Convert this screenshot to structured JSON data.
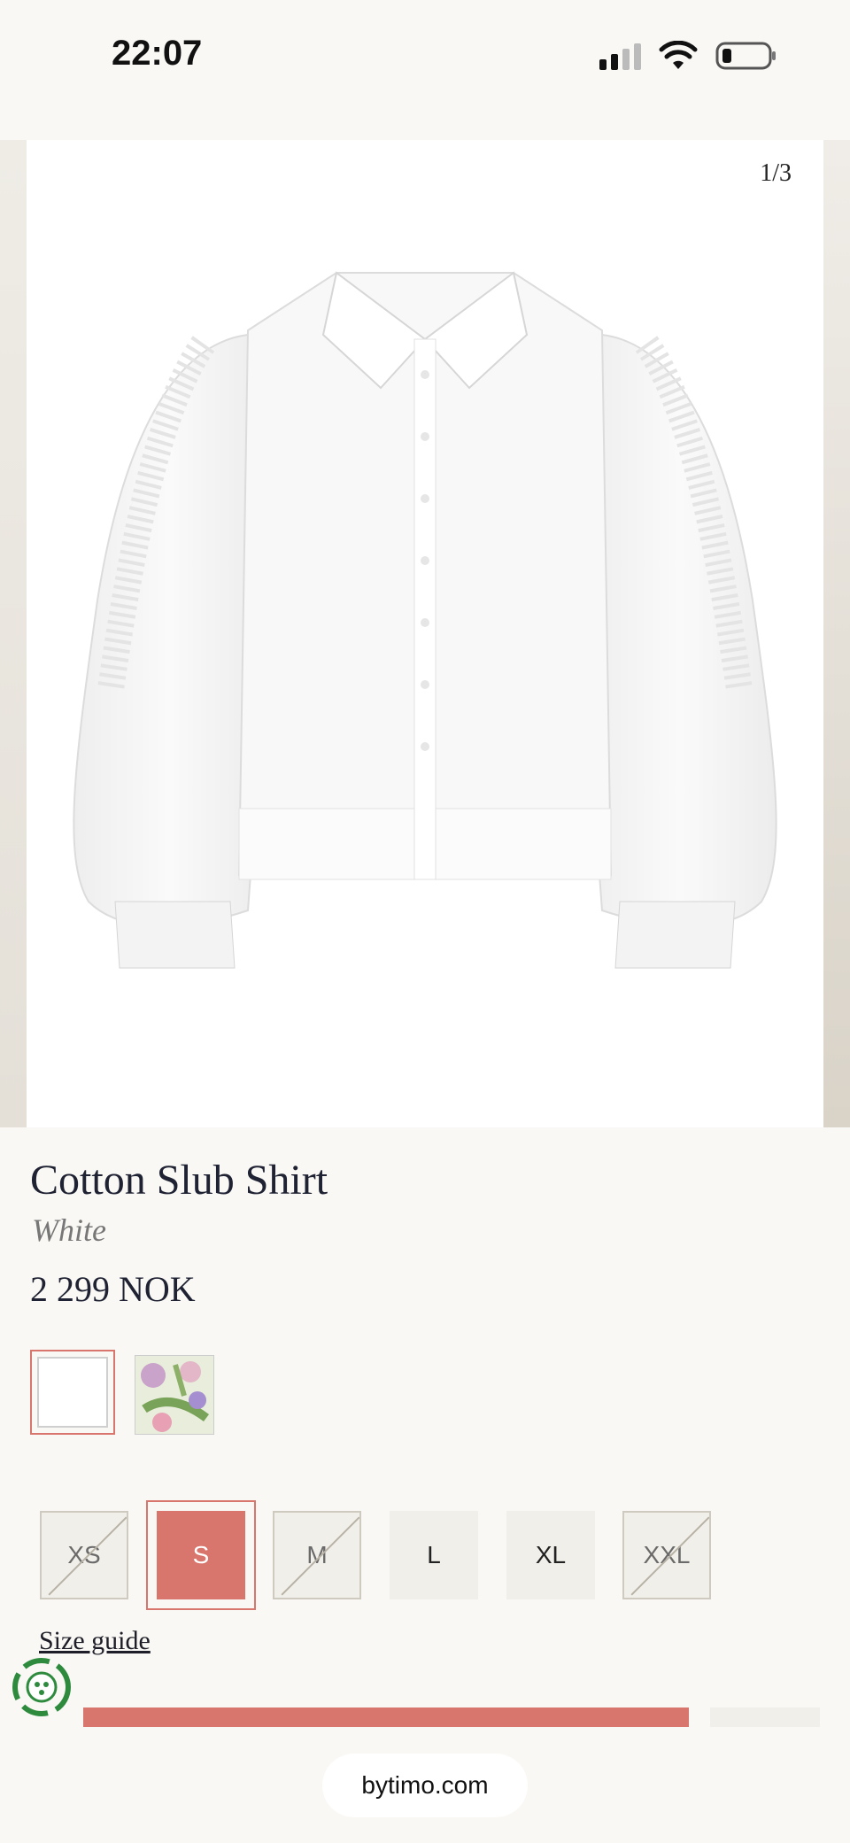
{
  "status_bar": {
    "time": "22:07"
  },
  "gallery": {
    "counter": "1/3",
    "image_alt": "white cotton shirt"
  },
  "product": {
    "title": "Cotton Slub Shirt",
    "color": "White",
    "price": "2 299 NOK"
  },
  "swatches": [
    {
      "name": "White",
      "selected": true
    },
    {
      "name": "Floral print",
      "selected": false
    }
  ],
  "sizes": [
    {
      "label": "XS",
      "available": false,
      "selected": false
    },
    {
      "label": "S",
      "available": true,
      "selected": true
    },
    {
      "label": "M",
      "available": false,
      "selected": false
    },
    {
      "label": "L",
      "available": true,
      "selected": false
    },
    {
      "label": "XL",
      "available": true,
      "selected": false
    },
    {
      "label": "XXL",
      "available": false,
      "selected": false
    }
  ],
  "size_guide_label": "Size guide",
  "carousel_progress": 0.86,
  "browser": {
    "url": "bytimo.com"
  },
  "colors": {
    "accent": "#d8766d",
    "background": "#faf8f4",
    "size_bg": "#f1efe9"
  }
}
